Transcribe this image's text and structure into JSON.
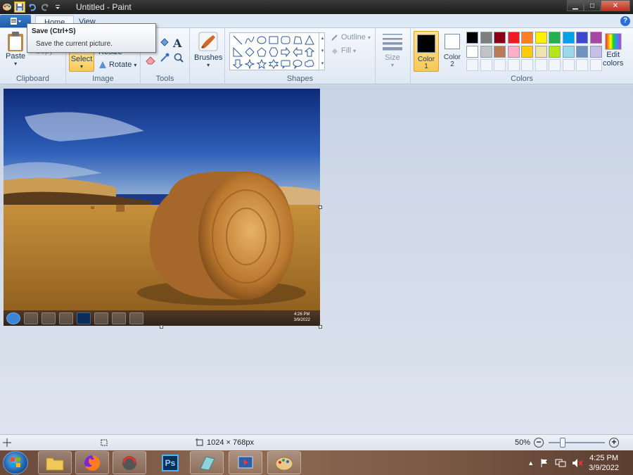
{
  "window": {
    "title": "Untitled - Paint",
    "controls": [
      "minimize",
      "maximize",
      "close"
    ]
  },
  "quick_access": [
    "save-icon",
    "undo-icon",
    "redo-icon",
    "customize-dropdown-icon"
  ],
  "tabs": [
    {
      "label": "Home",
      "active": true
    },
    {
      "label": "View",
      "active": false
    }
  ],
  "tooltip": {
    "title": "Save (Ctrl+S)",
    "description": "Save the current picture."
  },
  "ribbon": {
    "clipboard": {
      "label": "Clipboard",
      "paste": "Paste",
      "copy": "Copy"
    },
    "image": {
      "label": "Image",
      "select": "Select",
      "resize": "Resize",
      "rotate": "Rotate"
    },
    "tools": {
      "label": "Tools"
    },
    "brushes": {
      "label": "Brushes"
    },
    "shapes": {
      "label": "Shapes",
      "outline": "Outline",
      "fill": "Fill"
    },
    "size": {
      "label": "Size"
    },
    "colors": {
      "label": "Colors",
      "color1_label": "Color",
      "color1_num": "1",
      "color2_label": "Color",
      "color2_num": "2",
      "color1_value": "#000000",
      "color2_value": "#ffffff",
      "edit_colors": "Edit colors",
      "edit_colors_line1": "Edit",
      "edit_colors_line2": "colors",
      "palette_row1": [
        "#000000",
        "#7f7f7f",
        "#880015",
        "#ed1c24",
        "#ff7f27",
        "#fff200",
        "#22b14c",
        "#00a2e8",
        "#3f48cc",
        "#a349a4"
      ],
      "palette_row2": [
        "#ffffff",
        "#c3c3c3",
        "#b97a57",
        "#ffaec9",
        "#ffc90e",
        "#efe4b0",
        "#b5e61d",
        "#99d9ea",
        "#7092be",
        "#c8bfe7"
      ]
    }
  },
  "canvas_screenshot": {
    "clock_time": "4:26 PM",
    "clock_date": "3/9/2022"
  },
  "statusbar": {
    "dimensions": "1024 × 768px",
    "zoom": "50%",
    "zoom_fraction": 0.5
  },
  "taskbar": {
    "apps": [
      "folder-icon",
      "firefox-icon",
      "app-icon",
      "photoshop-icon",
      "notes-icon",
      "media-app-icon",
      "paint-icon"
    ],
    "photoshop_label": "Ps",
    "time": "4:25 PM",
    "date": "3/9/2022"
  }
}
